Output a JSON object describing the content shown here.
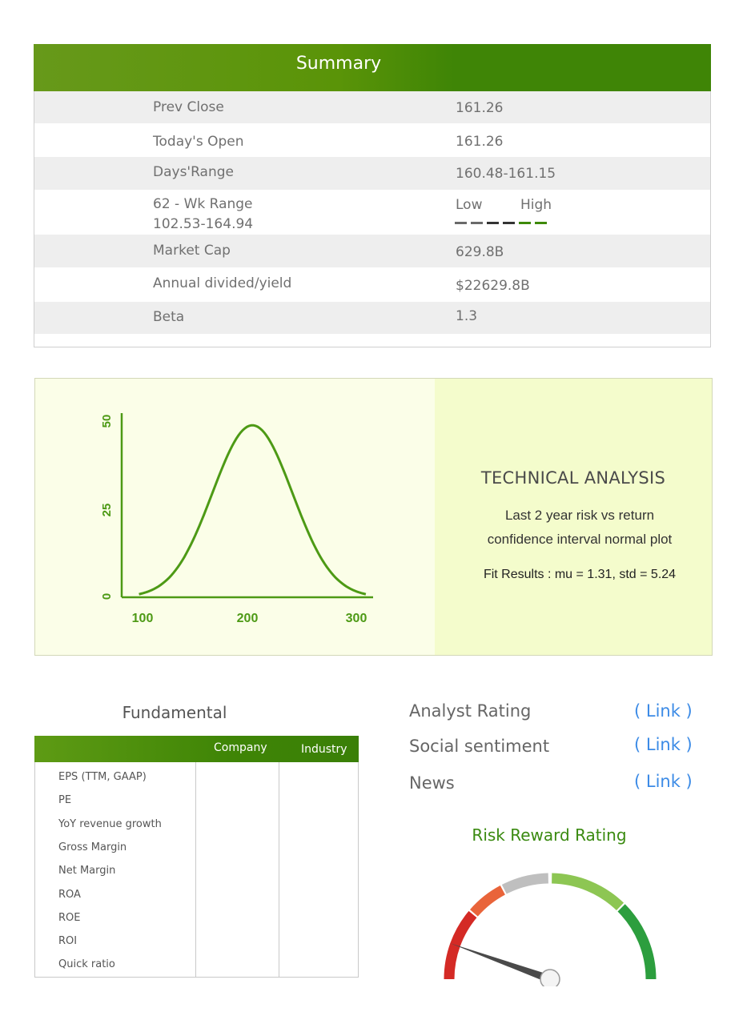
{
  "summary": {
    "title": "Summary",
    "rows": [
      {
        "label": "Prev Close",
        "value": "161.26"
      },
      {
        "label": "Today's Open",
        "value": "161.26"
      },
      {
        "label": "Days'Range",
        "value": "160.48-161.15"
      },
      {
        "label": "62 - Wk Range",
        "sublabel": "102.53-164.94",
        "low_label": "Low",
        "high_label": "High"
      },
      {
        "label": "Market Cap",
        "value": "629.8B"
      },
      {
        "label": "Annual divided/yield",
        "value": "$22629.8B"
      },
      {
        "label": "Beta",
        "value": "1.3"
      }
    ],
    "range_bar_colors": [
      "#6a6a6a",
      "#6a6a6a",
      "#333333",
      "#333333",
      "#3e8a0a",
      "#3e8a0a"
    ]
  },
  "technical": {
    "title": "TECHNICAL ANALYSIS",
    "line1": "Last 2 year risk vs return",
    "line2": "confidence interval normal plot",
    "fit": "Fit Results : mu = 1.31, std = 5.24"
  },
  "chart_data": {
    "type": "line",
    "x_ticks": [
      "100",
      "200",
      "300"
    ],
    "y_ticks": [
      "0",
      "25",
      "50"
    ],
    "xlim": [
      100,
      300
    ],
    "ylim": [
      0,
      50
    ],
    "curve": {
      "mean": 205,
      "std": 37,
      "peak": 49
    },
    "color": "#4d9a15"
  },
  "fundamental": {
    "title": "Fundamental",
    "col_company": "Company",
    "col_industry": "Industry",
    "items": [
      "EPS (TTM, GAAP)",
      "PE",
      "YoY revenue growth",
      "Gross Margin",
      "Net Margin",
      "ROA",
      "ROE",
      "ROI",
      "Quick ratio"
    ]
  },
  "links": [
    {
      "label": "Analyst Rating",
      "link": "( Link )"
    },
    {
      "label": "Social sentiment",
      "link": "( Link )"
    },
    {
      "label": "News",
      "link": "( Link )"
    }
  ],
  "gauge": {
    "title": "Risk Reward Rating",
    "value_fraction": 0.11,
    "colors": {
      "red": "#d42a25",
      "orange": "#e9643a",
      "gray": "#bfbfbf",
      "lightgreen": "#8dc653",
      "green": "#2c9e3e"
    }
  }
}
